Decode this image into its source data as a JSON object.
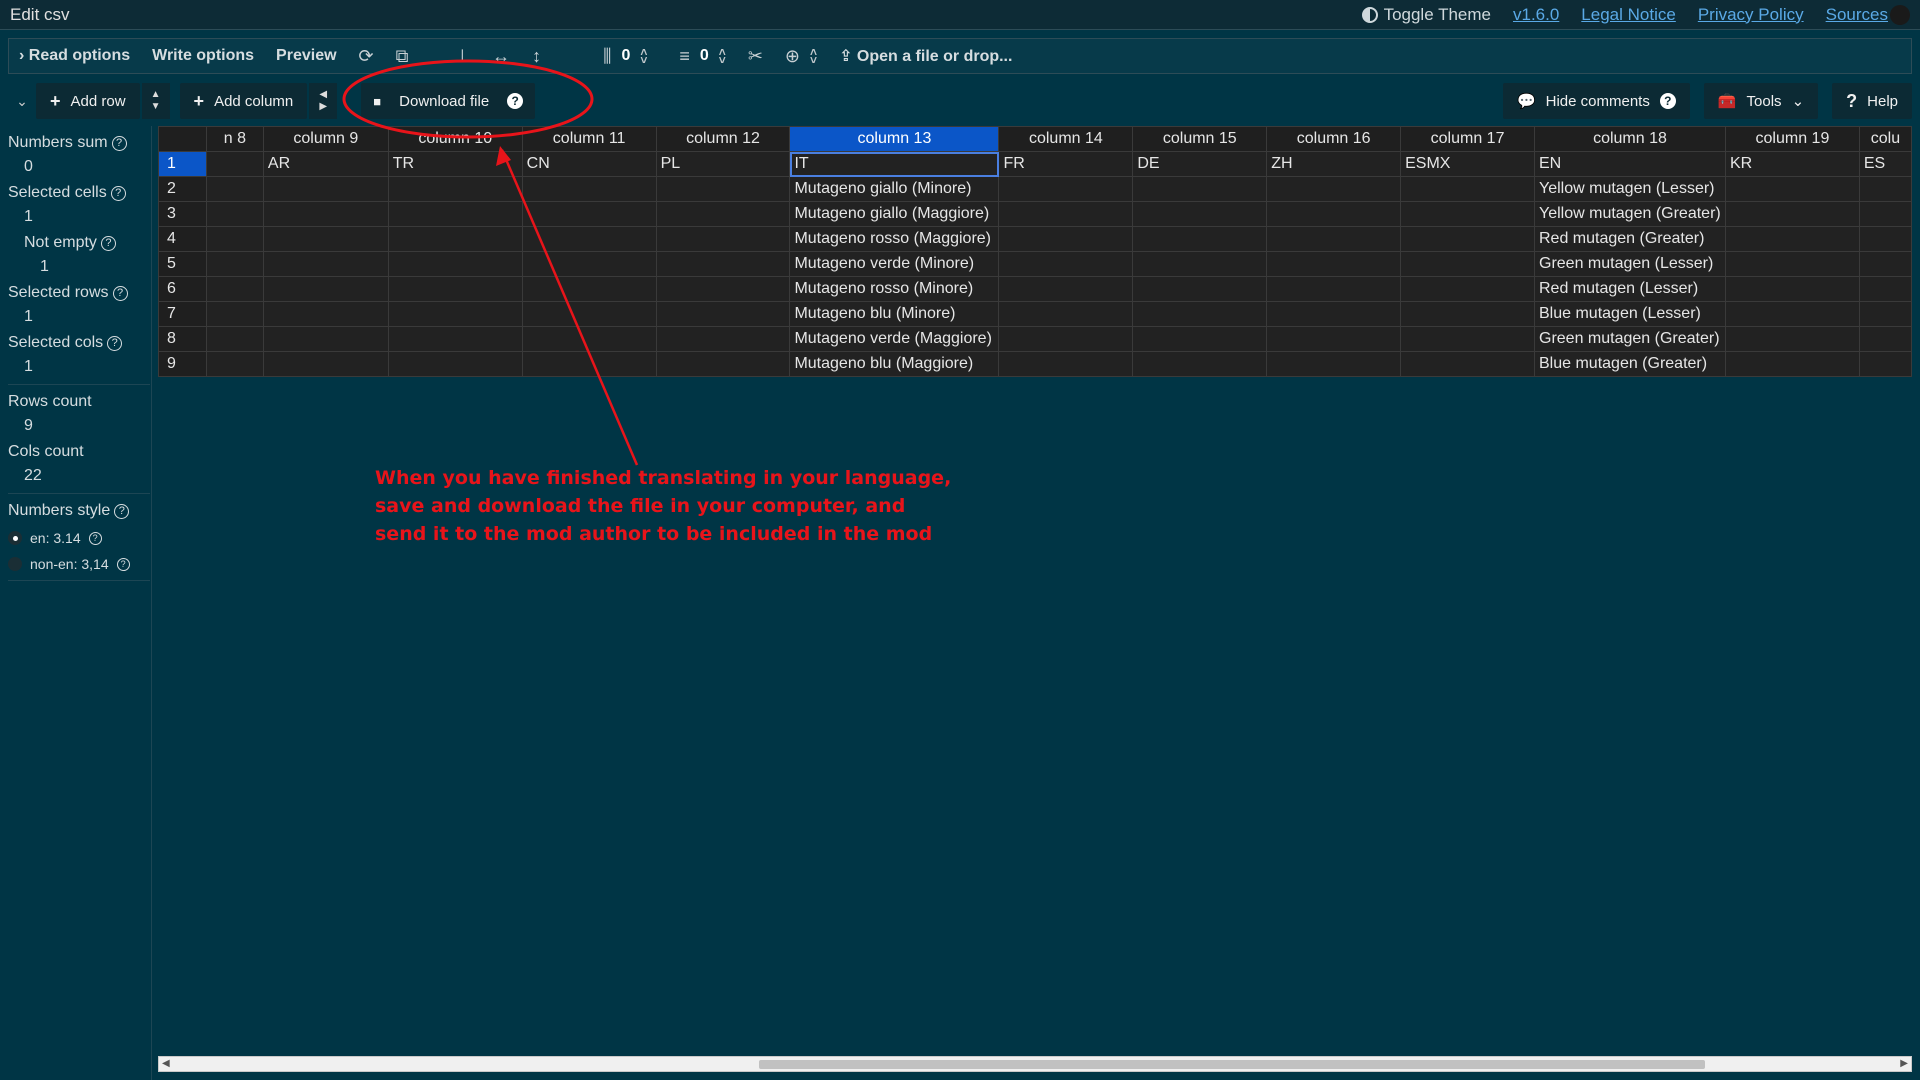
{
  "window": {
    "title": "Edit csv",
    "toggle_theme": "Toggle Theme",
    "links": [
      "v1.6.0",
      "Legal Notice",
      "Privacy Policy",
      "Sources"
    ]
  },
  "options_bar": {
    "read_options": "Read options",
    "write_options": "Write options",
    "preview": "Preview",
    "fixed_cols_value": "0",
    "fixed_rows_value": "0",
    "open_file": "Open a file or drop..."
  },
  "actions": {
    "add_row": "Add row",
    "add_column": "Add column",
    "download_file": "Download file",
    "hide_comments": "Hide comments",
    "tools": "Tools",
    "help": "Help"
  },
  "sidebar": {
    "numbers_sum_label": "Numbers sum",
    "numbers_sum": "0",
    "selected_cells_label": "Selected cells",
    "selected_cells": "1",
    "not_empty_label": "Not empty",
    "not_empty": "1",
    "selected_rows_label": "Selected rows",
    "selected_rows": "1",
    "selected_cols_label": "Selected cols",
    "selected_cols": "1",
    "rows_count_label": "Rows count",
    "rows_count": "9",
    "cols_count_label": "Cols count",
    "cols_count": "22",
    "numbers_style_label": "Numbers style",
    "style_en": "en: 3.14",
    "style_non_en": "non-en: 3,14"
  },
  "table": {
    "columns": [
      "n 8",
      "column 9",
      "column 10",
      "column 11",
      "column 12",
      "column 13",
      "column 14",
      "column 15",
      "column 16",
      "column 17",
      "column 18",
      "column 19",
      "colu"
    ],
    "selected_column": "column 13",
    "rows": [
      {
        "n": "1",
        "cells": [
          "",
          "AR",
          "TR",
          "CN",
          "PL",
          "IT",
          "FR",
          "DE",
          "ZH",
          "ESMX",
          "EN",
          "KR",
          "ES"
        ]
      },
      {
        "n": "2",
        "cells": [
          "",
          "",
          "",
          "",
          "",
          "Mutageno giallo (Minore)",
          "",
          "",
          "",
          "",
          "Yellow mutagen (Lesser)",
          "",
          ""
        ]
      },
      {
        "n": "3",
        "cells": [
          "",
          "",
          "",
          "",
          "",
          "Mutageno giallo (Maggiore)",
          "",
          "",
          "",
          "",
          "Yellow mutagen (Greater)",
          "",
          ""
        ]
      },
      {
        "n": "4",
        "cells": [
          "",
          "",
          "",
          "",
          "",
          "Mutageno rosso (Maggiore)",
          "",
          "",
          "",
          "",
          "Red mutagen (Greater)",
          "",
          ""
        ]
      },
      {
        "n": "5",
        "cells": [
          "",
          "",
          "",
          "",
          "",
          "Mutageno verde (Minore)",
          "",
          "",
          "",
          "",
          "Green mutagen (Lesser)",
          "",
          ""
        ]
      },
      {
        "n": "6",
        "cells": [
          "",
          "",
          "",
          "",
          "",
          "Mutageno rosso (Minore)",
          "",
          "",
          "",
          "",
          "Red mutagen (Lesser)",
          "",
          ""
        ]
      },
      {
        "n": "7",
        "cells": [
          "",
          "",
          "",
          "",
          "",
          "Mutageno blu (Minore)",
          "",
          "",
          "",
          "",
          "Blue mutagen (Lesser)",
          "",
          ""
        ]
      },
      {
        "n": "8",
        "cells": [
          "",
          "",
          "",
          "",
          "",
          "Mutageno verde (Maggiore)",
          "",
          "",
          "",
          "",
          "Green mutagen (Greater)",
          "",
          ""
        ]
      },
      {
        "n": "9",
        "cells": [
          "",
          "",
          "",
          "",
          "",
          "Mutageno blu (Maggiore)",
          "",
          "",
          "",
          "",
          "Blue mutagen (Greater)",
          "",
          ""
        ]
      }
    ]
  },
  "annotation": {
    "text": "When you have finished translating in your language, save and download the file in your computer, and send it to the mod author to be included in the mod",
    "color": "#e8141a"
  }
}
